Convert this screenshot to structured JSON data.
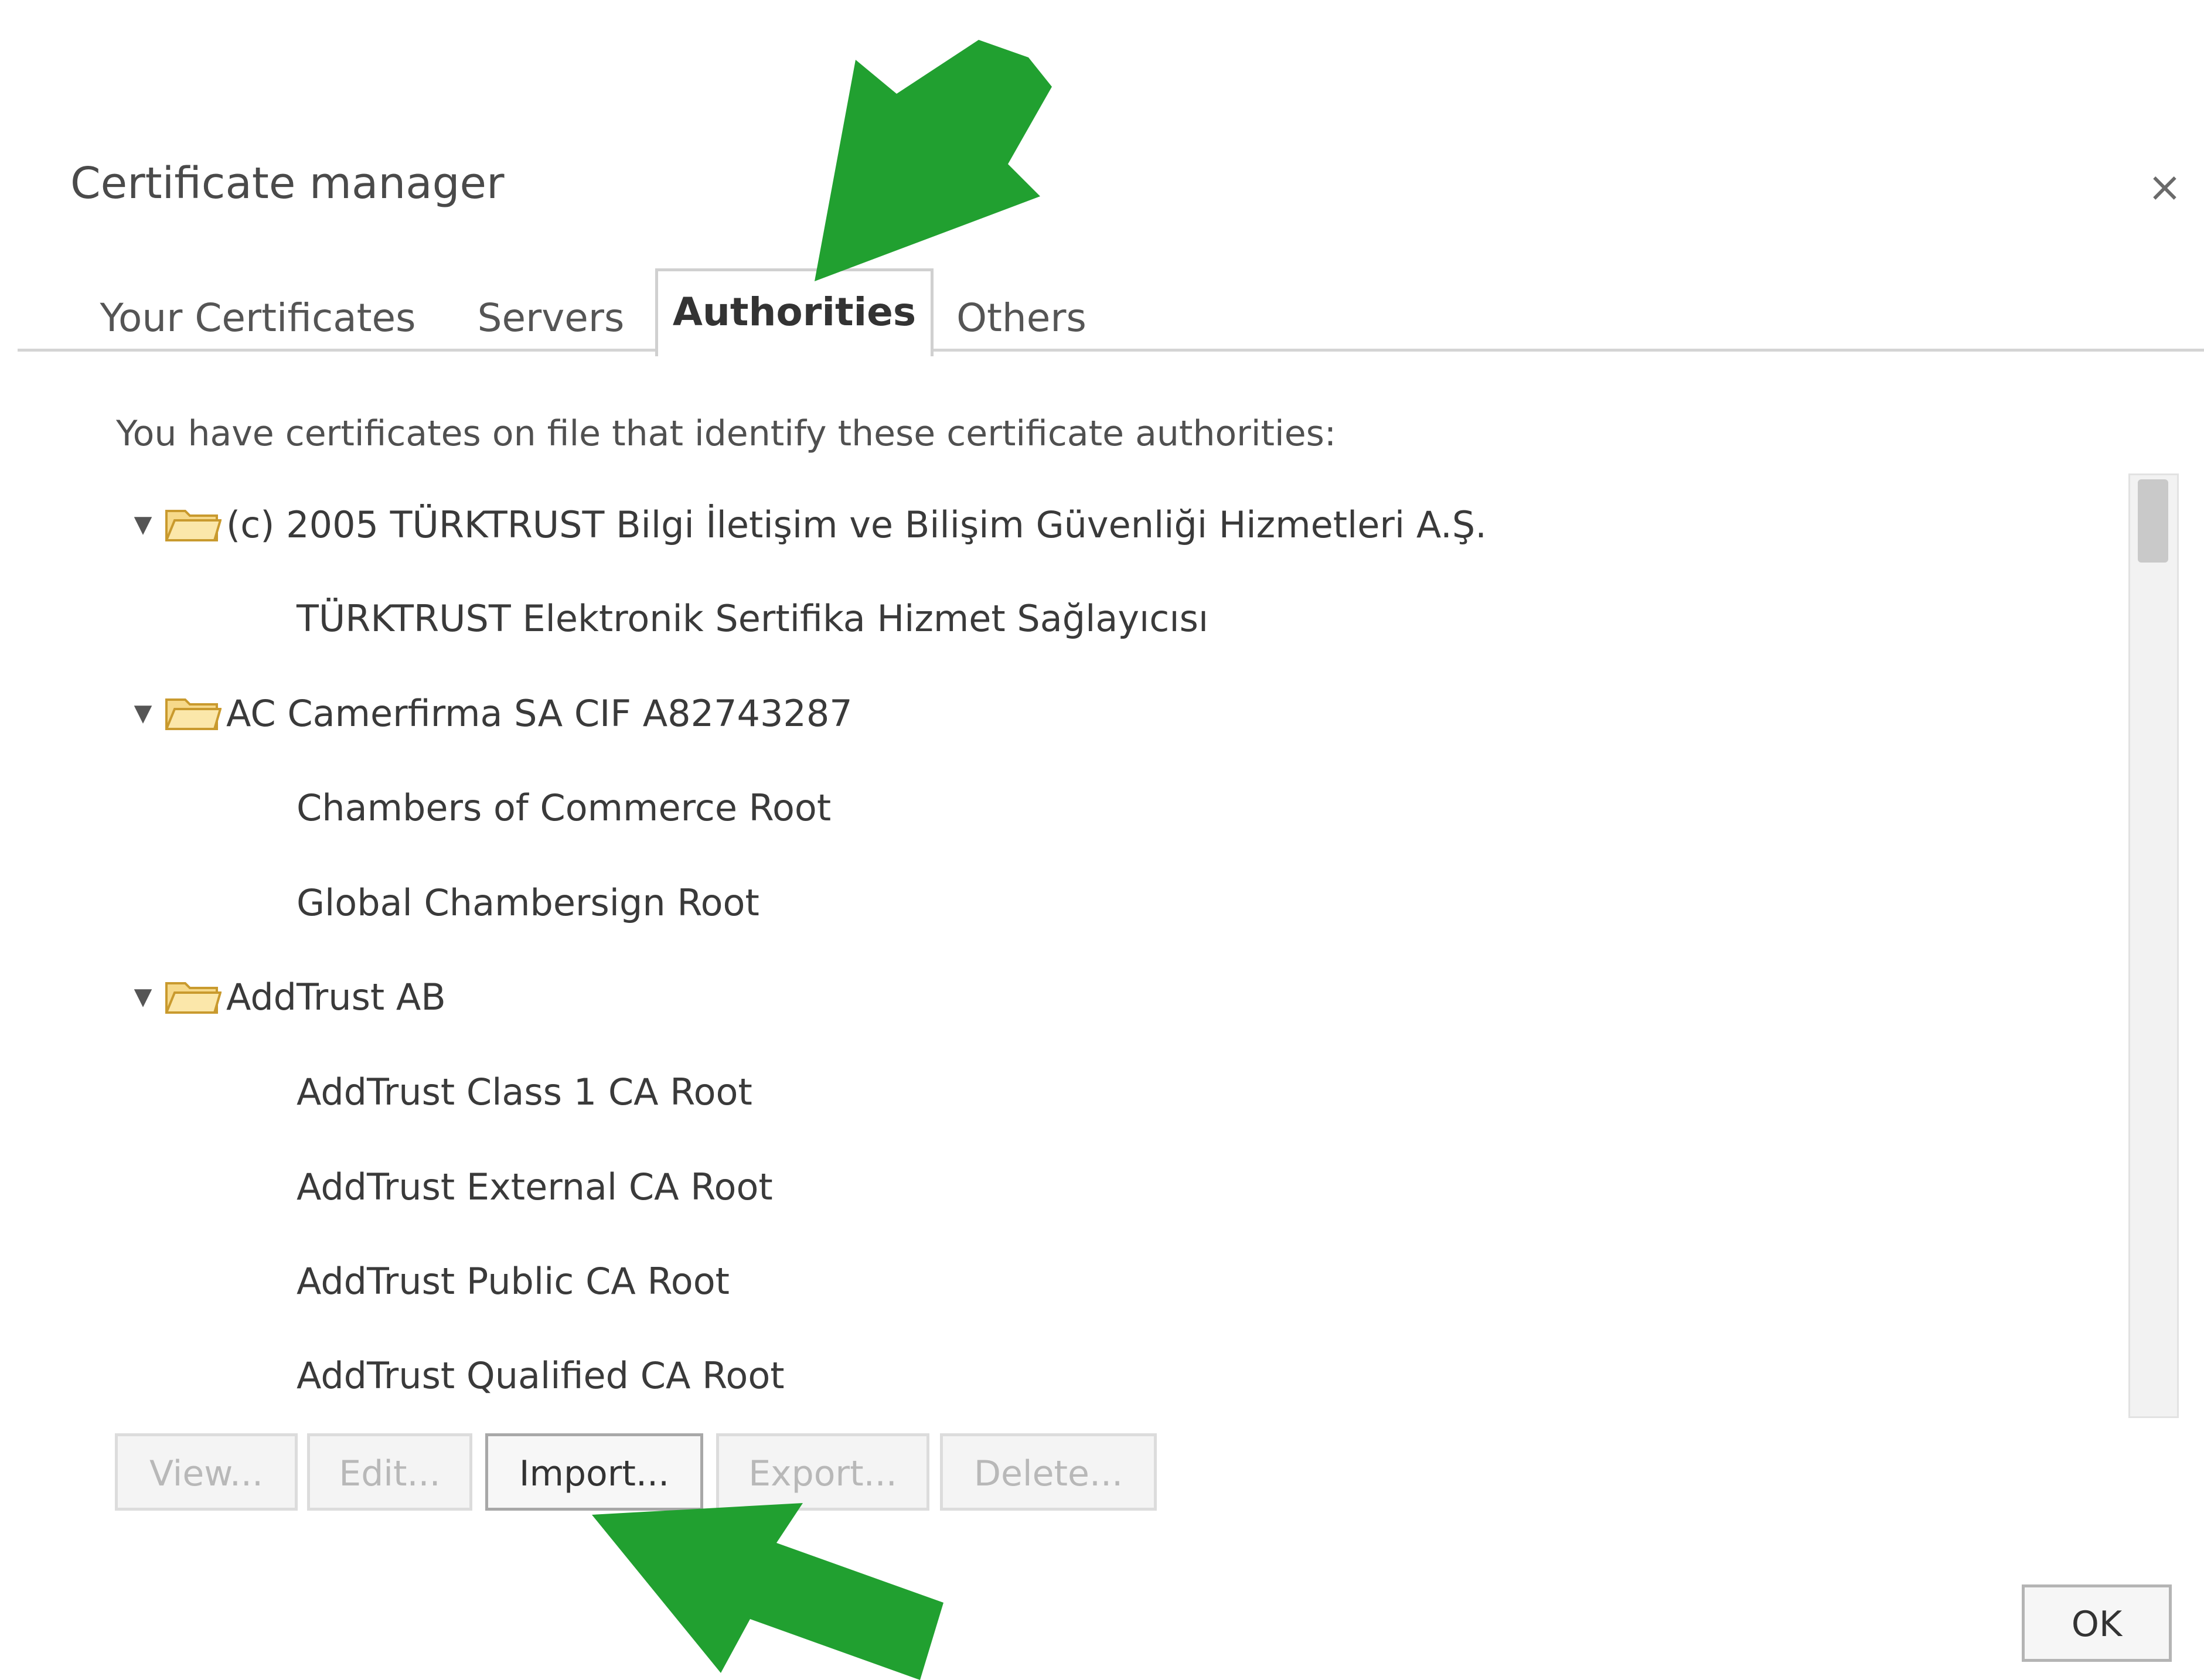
{
  "dialog": {
    "title": "Certificate manager",
    "close_glyph": "×"
  },
  "tabs": [
    {
      "label": "Your Certificates",
      "active": false
    },
    {
      "label": "Servers",
      "active": false
    },
    {
      "label": "Authorities",
      "active": true
    },
    {
      "label": "Others",
      "active": false
    }
  ],
  "intro_text": "You have certificates on file that identify these certificate authorities:",
  "tree": {
    "groups": [
      {
        "label": "(c) 2005 TÜRKTRUST Bilgi İletişim ve Bilişim Güvenliği Hizmetleri A.Ş.",
        "expanded": true,
        "children": [
          "TÜRKTRUST Elektronik Sertifika Hizmet Sağlayıcısı"
        ]
      },
      {
        "label": "AC Camerfirma SA CIF A82743287",
        "expanded": true,
        "children": [
          "Chambers of Commerce Root",
          "Global Chambersign Root"
        ]
      },
      {
        "label": "AddTrust AB",
        "expanded": true,
        "children": [
          "AddTrust Class 1 CA Root",
          "AddTrust External CA Root",
          "AddTrust Public CA Root",
          "AddTrust Qualified CA Root"
        ]
      }
    ],
    "caret_glyph": "▼",
    "folder_icon": "folder-icon"
  },
  "buttons": {
    "view": {
      "label": "View...",
      "enabled": false
    },
    "edit": {
      "label": "Edit...",
      "enabled": false
    },
    "import": {
      "label": "Import...",
      "enabled": true
    },
    "export": {
      "label": "Export...",
      "enabled": false
    },
    "delete": {
      "label": "Delete...",
      "enabled": false
    },
    "ok": {
      "label": "OK"
    }
  },
  "annotations": {
    "arrow_color": "#21a030",
    "arrow_icon": "arrow-icon"
  }
}
